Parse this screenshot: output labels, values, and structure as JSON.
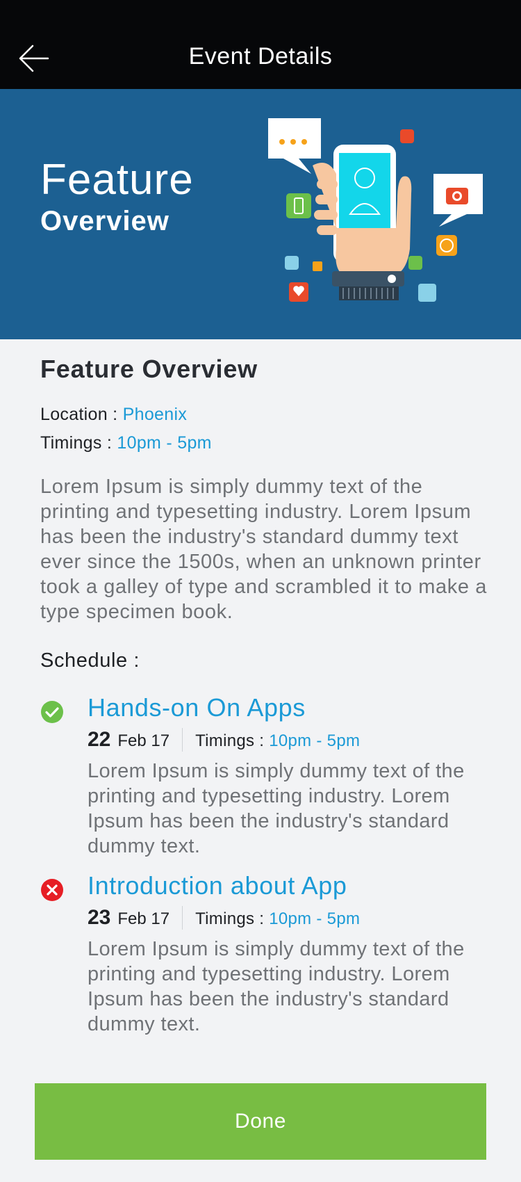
{
  "header": {
    "title": "Event Details",
    "back_icon": "arrow-left-icon"
  },
  "hero": {
    "line1": "Feature",
    "line2": "Overview",
    "background": "#1c6092",
    "illustration": "smartphone-in-hand-illustration"
  },
  "event": {
    "title": "Feature Overview",
    "location_label": "Location : ",
    "location_value": "Phoenix",
    "timings_label": "Timings : ",
    "timings_value": "10pm - 5pm",
    "description": "Lorem Ipsum is simply dummy text of the printing and typesetting industry. Lorem Ipsum has been the industry's standard dummy text ever since the 1500s, when an unknown printer took a galley of type and scrambled it to make a type specimen book."
  },
  "schedule": {
    "heading": "Schedule :",
    "items": [
      {
        "status": "completed",
        "status_icon": "check-circle-icon",
        "status_color": "#6cc04a",
        "title": "Hands-on On Apps",
        "day": "22",
        "month": "Feb 17",
        "timings_label": "Timings : ",
        "timings_value": "10pm - 5pm",
        "description": "Lorem Ipsum is simply dummy text of the printing and typesetting industry. Lorem Ipsum has been the industry's standard dummy text."
      },
      {
        "status": "cancelled",
        "status_icon": "x-circle-icon",
        "status_color": "#e61e25",
        "title": "Introduction about App",
        "day": "23",
        "month": "Feb 17",
        "timings_label": "Timings : ",
        "timings_value": "10pm - 5pm",
        "description": "Lorem Ipsum is simply dummy text of the printing and typesetting industry. Lorem Ipsum has been the industry's standard dummy text."
      }
    ]
  },
  "actions": {
    "done_label": "Done"
  },
  "colors": {
    "accent": "#1b9ad6",
    "done_button": "#78bd43",
    "topbar": "#060709"
  }
}
